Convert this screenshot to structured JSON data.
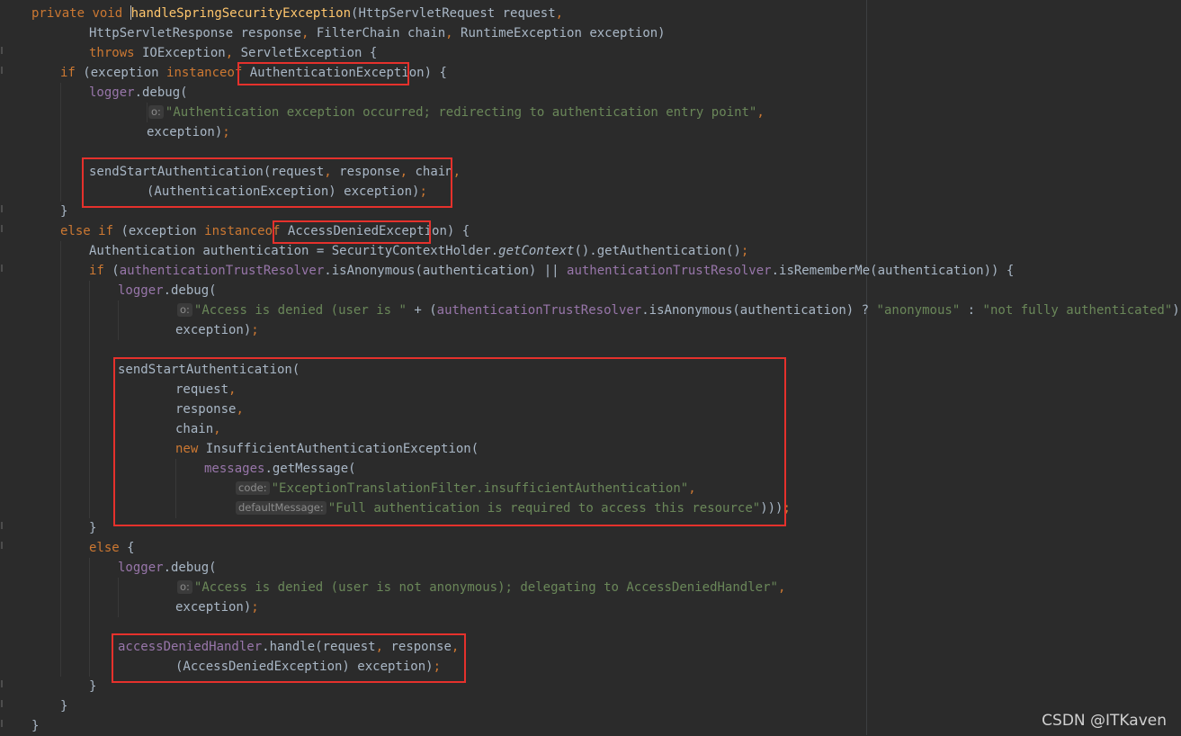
{
  "code": {
    "l1": {
      "kw1": "private",
      "kw2": "void",
      "method": "handleSpringSecurityException",
      "rest": "(HttpServletRequest request",
      ",": ","
    },
    "l2": {
      "t1": "HttpServletResponse response",
      ",1": ",",
      "t2": " FilterChain chain",
      ",2": ",",
      "t3": " RuntimeException exception)"
    },
    "l3": {
      "kw": "throws",
      "t1": " IOException",
      ",": ",",
      "t2": " ServletException {"
    },
    "l4": {
      "kw": "if",
      "t1": " (exception ",
      "kw2": "instanceof",
      "t2": " ",
      "cls": "AuthenticationException",
      "t3": ") {"
    },
    "l5": {
      "fld": "logger",
      "t": ".debug("
    },
    "l6": {
      "hint": "o:",
      "str": "\"Authentication exception occurred; redirecting to authentication entry point\"",
      ",": ","
    },
    "l7": {
      "t": "exception)",
      ";": ";"
    },
    "l9": {
      "t1": "sendStartAuthentication(request",
      ",1": ",",
      "t2": " response",
      ",2": ",",
      "t3": " chain",
      ",3": ","
    },
    "l10": {
      "t": "(AuthenticationException) exception)",
      ";": ";"
    },
    "l11": {
      "t": "}"
    },
    "l12": {
      "kw": "else if",
      "t1": " (exception ",
      "kw2": "instanceof",
      "t2": " ",
      "cls": "AccessDeniedException",
      "t3": ") {"
    },
    "l13": {
      "t1": "Authentication authentication = SecurityContextHolder.",
      "it": "getContext",
      "t2": "().getAuthentication()",
      ";": ";"
    },
    "l14": {
      "kw": "if",
      "t1": " (",
      "fld1": "authenticationTrustResolver",
      "t2": ".isAnonymous(authentication) || ",
      "fld2": "authenticationTrustResolver",
      "t3": ".isRememberMe(authentication)) {"
    },
    "l15": {
      "fld": "logger",
      "t": ".debug("
    },
    "l16": {
      "hint": "o:",
      "s1": "\"Access is denied (user is \"",
      "t1": " + (",
      "fld": "authenticationTrustResolver",
      "t2": ".isAnonymous(authentication) ? ",
      "s2": "\"anonymous\"",
      "t3": " : ",
      "s3": "\"not fully authenticated\"",
      "t4": ") + ",
      "s4": "\")",
      "t5": ";"
    },
    "l17": {
      "t": "exception)",
      ";": ";"
    },
    "l19": {
      "t": "sendStartAuthentication("
    },
    "l20": {
      "t": "request",
      ",": ","
    },
    "l21": {
      "t": "response",
      ",": ","
    },
    "l22": {
      "t": "chain",
      ",": ","
    },
    "l23": {
      "kw": "new",
      "t": " InsufficientAuthenticationException("
    },
    "l24": {
      "fld": "messages",
      "t": ".getMessage("
    },
    "l25": {
      "hint": "code:",
      "str": "\"ExceptionTranslationFilter.insufficientAuthentication\"",
      ",": ","
    },
    "l26": {
      "hint": "defaultMessage:",
      "str": "\"Full authentication is required to access this resource\"",
      "t": ")))",
      ";": ";"
    },
    "l27": {
      "t": "}"
    },
    "l28": {
      "kw": "else",
      "t": " {"
    },
    "l29": {
      "fld": "logger",
      "t": ".debug("
    },
    "l30": {
      "hint": "o:",
      "str": "\"Access is denied (user is not anonymous); delegating to AccessDeniedHandler\"",
      ",": ","
    },
    "l31": {
      "t": "exception)",
      ";": ";"
    },
    "l33": {
      "fld": "accessDeniedHandler",
      "t1": ".handle(request",
      ",1": ",",
      "t2": " response",
      ",2": ","
    },
    "l34": {
      "t": "(AccessDeniedException) exception)",
      ";": ";"
    },
    "l35": {
      "t": "}"
    },
    "l36": {
      "t": "}"
    },
    "l37": {
      "t": "}"
    }
  },
  "watermark": "CSDN @ITKaven",
  "colors": {
    "background": "#2b2b2b",
    "keyword": "#cc7832",
    "method": "#ffc66d",
    "field": "#9876aa",
    "string": "#6a8759",
    "text": "#a9b7c6",
    "highlight_box": "#e5312c"
  }
}
